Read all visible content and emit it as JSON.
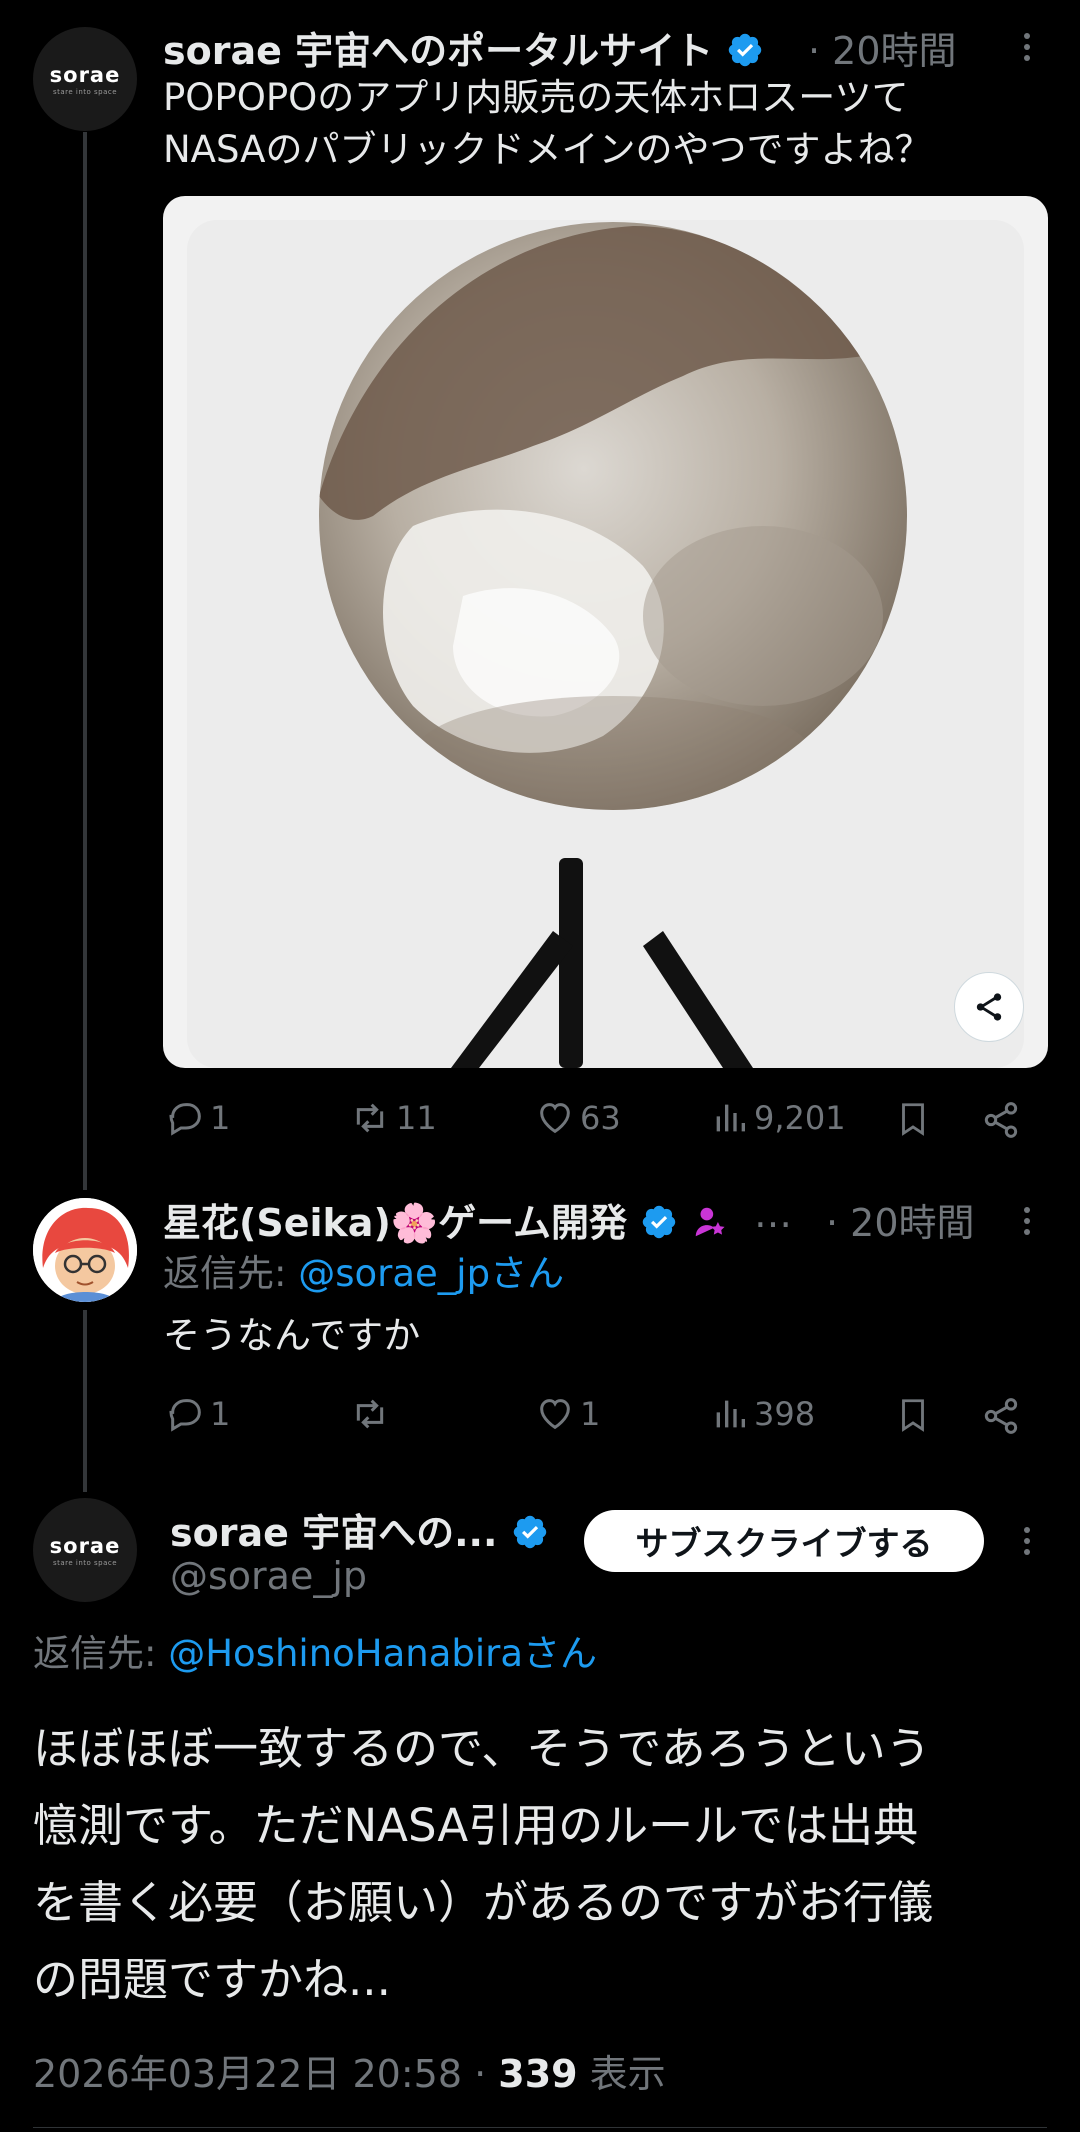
{
  "tweet1": {
    "author": "sorae 宇宙へのポータルサイト",
    "avatar_logo": "sorae",
    "avatar_sub": "stare into space",
    "time": "· 20時間",
    "text_line1": "POPOPOのアプリ内販売の天体ホロスーツて",
    "text_line2": "NASAのパブリックドメインのやつですよね？",
    "actions": {
      "reply": "1",
      "retweet": "11",
      "like": "63",
      "views": "9,201"
    }
  },
  "tweet2": {
    "author": "星花(Seika)🌸ゲーム開発",
    "ellipsis": "…",
    "time": "· 20時間",
    "reply_to_prefix": "返信先: ",
    "reply_to_handle": "@sorae_jpさん",
    "text": "そうなんですか",
    "actions": {
      "reply": "1",
      "retweet": "",
      "like": "1",
      "views": "398"
    }
  },
  "main_tweet": {
    "author": "sorae 宇宙への...",
    "handle": "@sorae_jp",
    "avatar_logo": "sorae",
    "avatar_sub": "stare into space",
    "subscribe_label": "サブスクライブする",
    "reply_to_prefix": "返信先: ",
    "reply_to_handle": "@HoshinoHanabiraさん",
    "text_lines": [
      "ほぼほぼ一致するので、そうであろうという",
      "憶測です。ただNASA引用のルールでは出典",
      "を書く必要（お願い）があるのですがお行儀",
      "の問題ですかね..."
    ],
    "timestamp": "2026年03月22日 20:58",
    "separator": " · ",
    "views_count": "339",
    "views_label": " 表示"
  },
  "colors": {
    "background": "#000000",
    "text": "#e7e9ea",
    "muted": "#71767b",
    "link": "#1d9bf0",
    "verified": "#1d9bf0"
  }
}
